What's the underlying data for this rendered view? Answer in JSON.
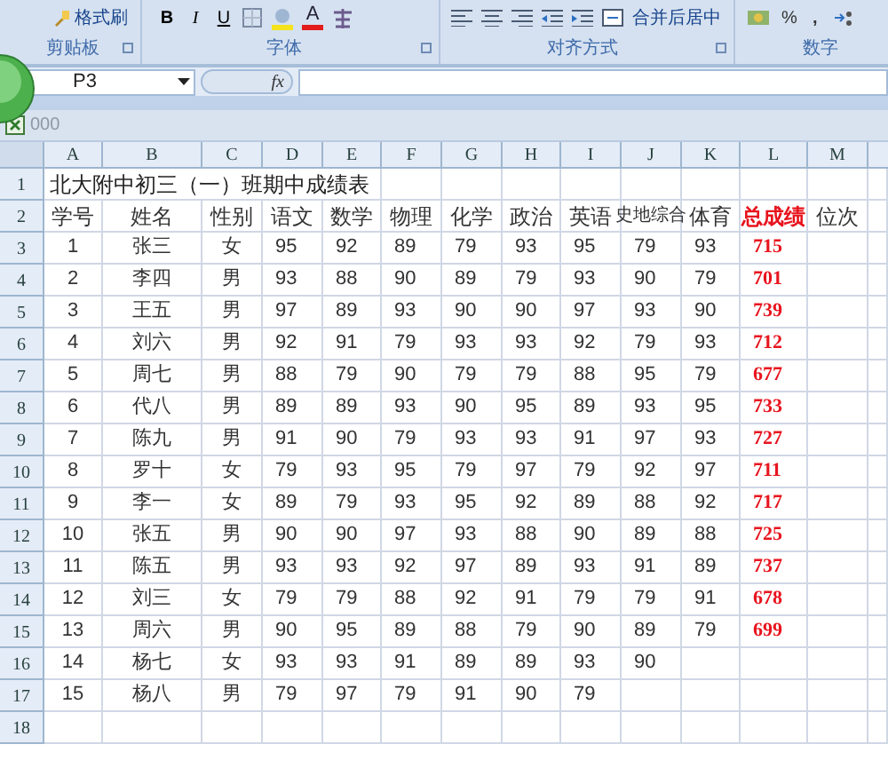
{
  "ribbon": {
    "clipboard": {
      "format_painter": "格式刷",
      "label": "剪贴板"
    },
    "font": {
      "bold": "B",
      "italic": "I",
      "underline": "U",
      "font_color": "A",
      "label": "字体"
    },
    "alignment": {
      "merge_center": "合并后居中",
      "label": "对齐方式"
    },
    "number": {
      "percent": "%",
      "comma": ",",
      "label": "数字"
    }
  },
  "formula_bar": {
    "name_box": "P3",
    "function_label": "fx"
  },
  "workbook": {
    "title": "000"
  },
  "sheet": {
    "columns": [
      {
        "letter": "A",
        "highlight": false
      },
      {
        "letter": "B",
        "highlight": false
      },
      {
        "letter": "C",
        "highlight": false
      },
      {
        "letter": "D",
        "highlight": false
      },
      {
        "letter": "E",
        "highlight": false
      },
      {
        "letter": "F",
        "highlight": false
      },
      {
        "letter": "G",
        "highlight": false
      },
      {
        "letter": "H",
        "highlight": false
      },
      {
        "letter": "I",
        "highlight": false
      },
      {
        "letter": "J",
        "highlight": false
      },
      {
        "letter": "K",
        "highlight": false
      },
      {
        "letter": "L",
        "highlight": true
      },
      {
        "letter": "M",
        "highlight": false
      }
    ],
    "rows": [
      {
        "number": "1",
        "title": "北大附中初三（一）班期中成绩表"
      },
      {
        "number": "2",
        "cells": [
          "学号",
          "姓名",
          "性别",
          "语文",
          "数学",
          "物理",
          "化学",
          "政治",
          "英语",
          "史地综合",
          "体育",
          "总成绩",
          "位次"
        ]
      },
      {
        "number": "3",
        "cells": [
          "1",
          "张三",
          "女",
          "95",
          "92",
          "89",
          "79",
          "93",
          "95",
          "79",
          "93",
          "715"
        ]
      },
      {
        "number": "4",
        "cells": [
          "2",
          "李四",
          "男",
          "93",
          "88",
          "90",
          "89",
          "79",
          "93",
          "90",
          "79",
          "701"
        ]
      },
      {
        "number": "5",
        "cells": [
          "3",
          "王五",
          "男",
          "97",
          "89",
          "93",
          "90",
          "90",
          "97",
          "93",
          "90",
          "739"
        ]
      },
      {
        "number": "6",
        "cells": [
          "4",
          "刘六",
          "男",
          "92",
          "91",
          "79",
          "93",
          "93",
          "92",
          "79",
          "93",
          "712"
        ]
      },
      {
        "number": "7",
        "cells": [
          "5",
          "周七",
          "男",
          "88",
          "79",
          "90",
          "79",
          "79",
          "88",
          "95",
          "79",
          "677"
        ]
      },
      {
        "number": "8",
        "cells": [
          "6",
          "代八",
          "男",
          "89",
          "89",
          "93",
          "90",
          "95",
          "89",
          "93",
          "95",
          "733"
        ]
      },
      {
        "number": "9",
        "cells": [
          "7",
          "陈九",
          "男",
          "91",
          "90",
          "79",
          "93",
          "93",
          "91",
          "97",
          "93",
          "727"
        ]
      },
      {
        "number": "10",
        "cells": [
          "8",
          "罗十",
          "女",
          "79",
          "93",
          "95",
          "79",
          "97",
          "79",
          "92",
          "97",
          "711"
        ]
      },
      {
        "number": "11",
        "cells": [
          "9",
          "李一",
          "女",
          "89",
          "79",
          "93",
          "95",
          "92",
          "89",
          "88",
          "92",
          "717"
        ]
      },
      {
        "number": "12",
        "cells": [
          "10",
          "张五",
          "男",
          "90",
          "90",
          "97",
          "93",
          "88",
          "90",
          "89",
          "88",
          "725"
        ]
      },
      {
        "number": "13",
        "cells": [
          "11",
          "陈五",
          "男",
          "93",
          "93",
          "92",
          "97",
          "89",
          "93",
          "91",
          "89",
          "737"
        ]
      },
      {
        "number": "14",
        "cells": [
          "12",
          "刘三",
          "女",
          "79",
          "79",
          "88",
          "92",
          "91",
          "79",
          "79",
          "91",
          "678"
        ]
      },
      {
        "number": "15",
        "cells": [
          "13",
          "周六",
          "男",
          "90",
          "95",
          "89",
          "88",
          "79",
          "90",
          "89",
          "79",
          "699"
        ]
      },
      {
        "number": "16",
        "cells": [
          "14",
          "杨七",
          "女",
          "93",
          "93",
          "91",
          "89",
          "89",
          "93",
          "90"
        ]
      },
      {
        "number": "17",
        "cells": [
          "15",
          "杨八",
          "男",
          "79",
          "97",
          "79",
          "91",
          "90",
          "79"
        ]
      },
      {
        "number": "18",
        "cells": []
      }
    ]
  }
}
